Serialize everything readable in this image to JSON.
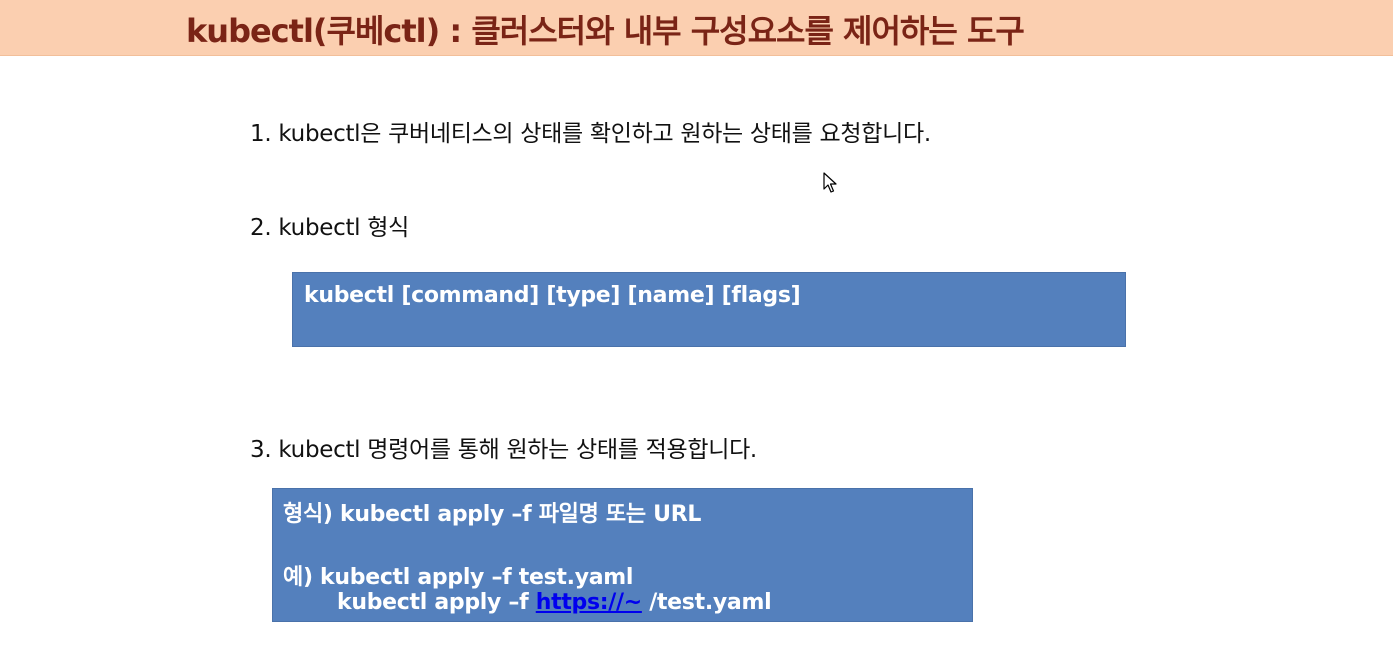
{
  "header": {
    "title": "kubectl(쿠베ctl) : 클러스터와 내부 구성요소를 제어하는 도구"
  },
  "items": [
    {
      "text": "1. kubectl은 쿠버네티스의 상태를 확인하고 원하는 상태를 요청합니다."
    },
    {
      "text": "2. kubectl 형식"
    },
    {
      "text": "3. kubectl 명령어를 통해 원하는 상태를 적용합니다."
    }
  ],
  "format_box": {
    "text": "kubectl  [command] [type] [name] [flags]"
  },
  "apply_box": {
    "format_line": "형식) kubectl apply –f 파일명 또는 URL",
    "example_line1": "예)  kubectl apply –f test.yaml",
    "example_line2_prefix": "kubectl apply –f ",
    "example_line2_link": "https://~",
    "example_line2_suffix": " /test.yaml"
  },
  "colors": {
    "title_bar": "#fbcfb0",
    "title_text": "#7a2416",
    "box_fill": "#5480bd",
    "link": "#0000ee"
  },
  "icons": {
    "cursor": "mouse-pointer-icon"
  }
}
